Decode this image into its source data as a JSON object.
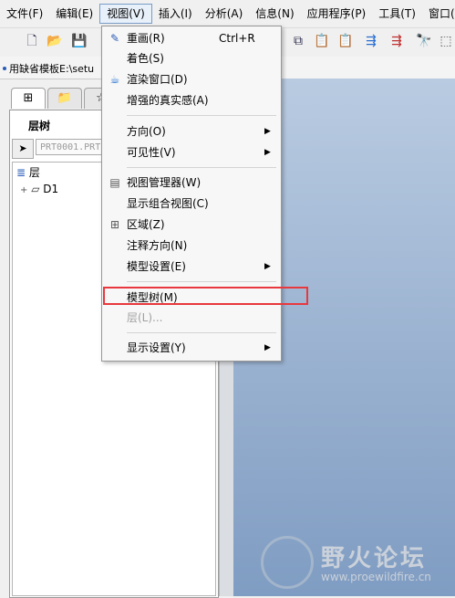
{
  "menubar": {
    "items": [
      {
        "label": "文件(F)"
      },
      {
        "label": "编辑(E)"
      },
      {
        "label": "视图(V)"
      },
      {
        "label": "插入(I)"
      },
      {
        "label": "分析(A)"
      },
      {
        "label": "信息(N)"
      },
      {
        "label": "应用程序(P)"
      },
      {
        "label": "工具(T)"
      },
      {
        "label": "窗口(W"
      }
    ]
  },
  "status_line": {
    "text": "用缺省模板E:\\setu"
  },
  "left_panel": {
    "title": "层树",
    "model_name": "PRT0001.PRT",
    "tree": {
      "root_label": "层",
      "child_label": "D1",
      "expander": "+"
    }
  },
  "view_menu": {
    "items": [
      {
        "label": "重画(R)",
        "shortcut": "Ctrl+R",
        "icon": "repaint-icon"
      },
      {
        "label": "着色(S)"
      },
      {
        "label": "渲染窗口(D)",
        "icon": "teapot-icon"
      },
      {
        "label": "增强的真实感(A)"
      },
      {
        "label": "方向(O)",
        "submenu": "▶"
      },
      {
        "label": "可见性(V)",
        "submenu": "▶"
      },
      {
        "label": "视图管理器(W)",
        "icon": "view-manager-icon"
      },
      {
        "label": "显示组合视图(C)"
      },
      {
        "label": "区域(Z)",
        "icon": "zone-icon"
      },
      {
        "label": "注释方向(N)"
      },
      {
        "label": "模型设置(E)",
        "submenu": "▶"
      },
      {
        "label": "模型树(M)"
      },
      {
        "label": "层(L)...",
        "disabled": true
      },
      {
        "label": "显示设置(Y)",
        "submenu": "▶"
      }
    ]
  },
  "watermark": {
    "title": "野火论坛",
    "url": "www.proewildfire.cn"
  },
  "colors": {
    "highlight_box": "#e8383d",
    "viewport_top": "#b9cbe1",
    "viewport_bottom": "#7f9cc2"
  }
}
